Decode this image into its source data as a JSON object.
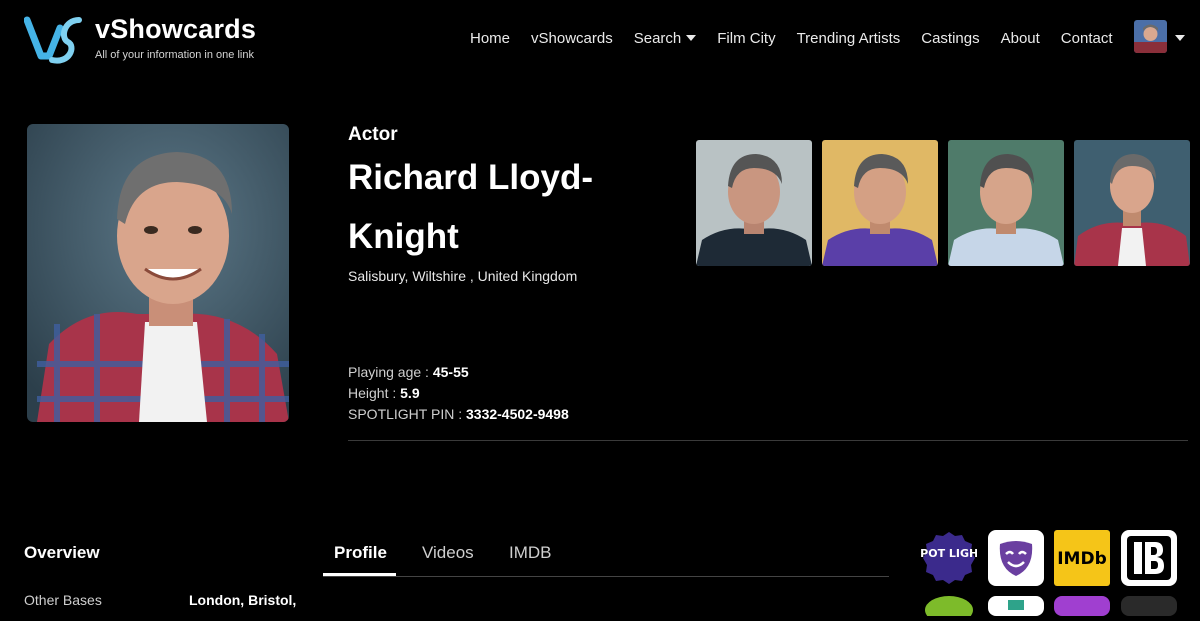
{
  "brand": {
    "name": "vShowcards",
    "tagline": "All of your information in one link"
  },
  "nav": {
    "items": [
      "Home",
      "vShowcards",
      "Search",
      "Film City",
      "Trending Artists",
      "Castings",
      "About",
      "Contact"
    ]
  },
  "profile": {
    "role": "Actor",
    "name": "Richard Lloyd-Knight",
    "location": "Salisbury, Wiltshire , United Kingdom",
    "playing_age_label": "Playing age :",
    "playing_age": "45-55",
    "height_label": "Height :",
    "height": "5.9",
    "spotlight_label": "SPOTLIGHT PIN :",
    "spotlight_pin": "3332-4502-9498"
  },
  "overview": {
    "title": "Overview",
    "other_bases_label": "Other Bases",
    "other_bases_value": "London, Bristol,"
  },
  "tabs": [
    "Profile",
    "Videos",
    "IMDB"
  ],
  "badges": {
    "spotlight_text": "SPOT LIGHT",
    "imdb_text": "IMDb"
  },
  "colors": {
    "logo_blue": "#45b3e6",
    "imdb_yellow": "#f5c518",
    "spotlight_purple": "#3b2a8c",
    "mask_purple": "#6a3fa0"
  }
}
